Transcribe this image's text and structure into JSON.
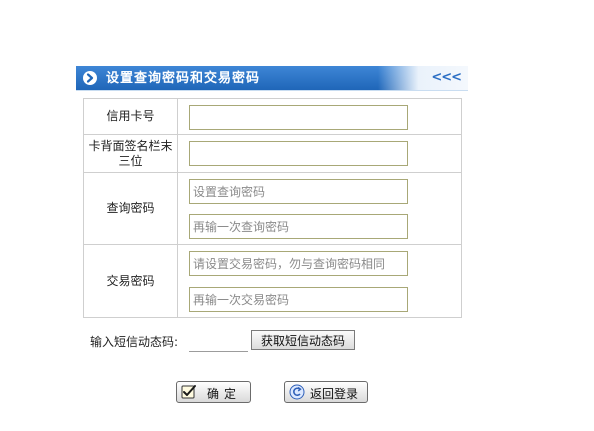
{
  "header": {
    "title": "设置查询密码和交易密码",
    "collapse_symbol": "<<<"
  },
  "form": {
    "card_number": {
      "label": "信用卡号",
      "value": ""
    },
    "cvv": {
      "label": "卡背面签名栏末三位",
      "value": ""
    },
    "query_password": {
      "label": "查询密码",
      "placeholder": "设置查询密码",
      "confirm_placeholder": "再输一次查询密码"
    },
    "trade_password": {
      "label": "交易密码",
      "placeholder": "请设置交易密码，勿与查询密码相同",
      "confirm_placeholder": "再输一次交易密码"
    }
  },
  "sms": {
    "label": "输入短信动态码:",
    "value": "",
    "button_label": "获取短信动态码"
  },
  "buttons": {
    "confirm_label": "确定",
    "back_label": "返回登录"
  },
  "colors": {
    "header_blue": "#1f66b8",
    "input_border": "#a8a877"
  }
}
